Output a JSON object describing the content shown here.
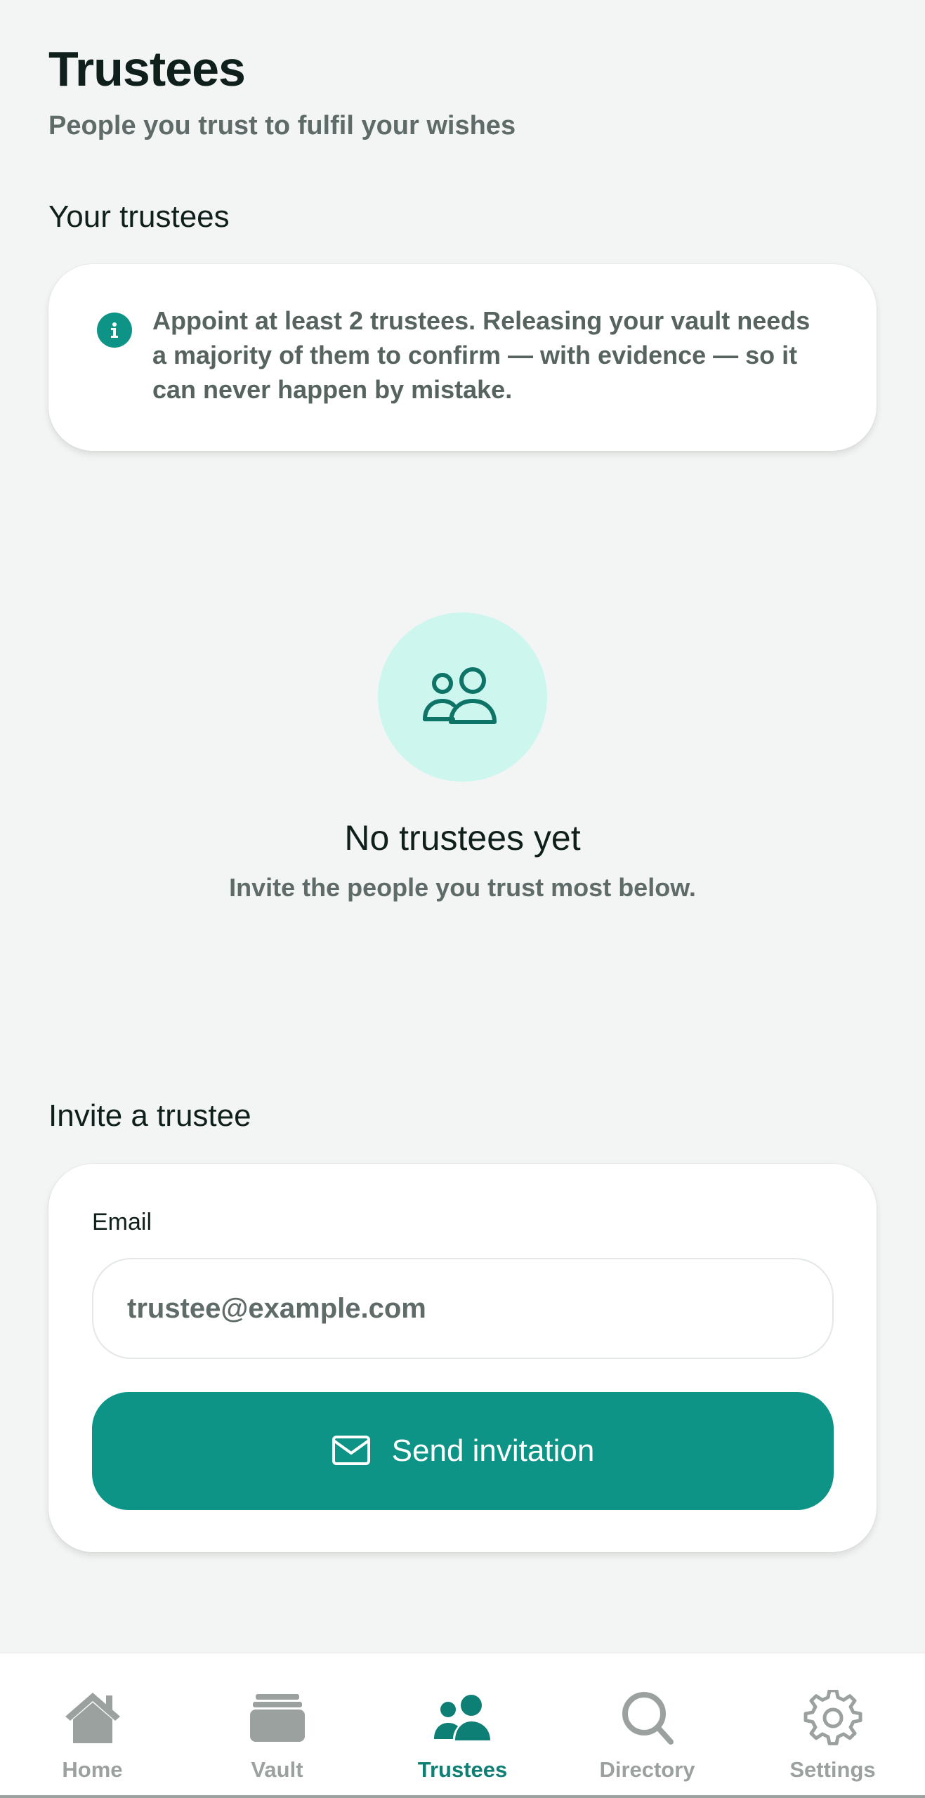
{
  "header": {
    "title": "Trustees",
    "subtitle": "People you trust to fulfil your wishes"
  },
  "trustees_section": {
    "title": "Your trustees",
    "info_text": "Appoint at least 2 trustees. Releasing your vault needs a majority of them to confirm — with evidence — so it can never happen by mistake.",
    "info_icon": "info-icon"
  },
  "empty_state": {
    "icon": "people-icon",
    "title": "No trustees yet",
    "subtitle": "Invite the people you trust most below."
  },
  "invite_section": {
    "title": "Invite a trustee",
    "email_label": "Email",
    "email_placeholder": "trustee@example.com",
    "email_value": "",
    "send_label": "Send invitation",
    "send_icon": "envelope-icon"
  },
  "bottom_nav": {
    "items": [
      {
        "label": "Home",
        "icon": "home-icon",
        "active": false
      },
      {
        "label": "Vault",
        "icon": "vault-icon",
        "active": false
      },
      {
        "label": "Trustees",
        "icon": "people-icon",
        "active": true
      },
      {
        "label": "Directory",
        "icon": "search-icon",
        "active": false
      },
      {
        "label": "Settings",
        "icon": "gear-icon",
        "active": false
      }
    ]
  },
  "colors": {
    "accent": "#0e9486",
    "accent_dark": "#0e7f74",
    "empty_circle": "#cdf7ee",
    "background": "#f3f5f4",
    "inactive_nav": "#9aa19f"
  }
}
